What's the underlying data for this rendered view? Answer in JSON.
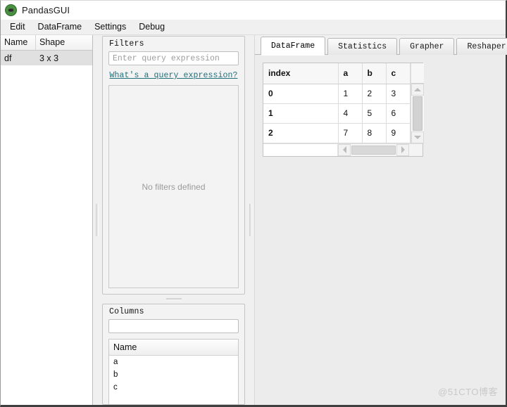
{
  "window": {
    "title": "PandasGUI",
    "icon": "pandas-logo-icon"
  },
  "menubar": {
    "items": [
      {
        "label": "Edit"
      },
      {
        "label": "DataFrame"
      },
      {
        "label": "Settings"
      },
      {
        "label": "Debug"
      }
    ]
  },
  "dataframe_list": {
    "headers": [
      "Name",
      "Shape"
    ],
    "rows": [
      {
        "name": "df",
        "shape": "3 x 3",
        "selected": true
      }
    ]
  },
  "filters": {
    "title": "Filters",
    "query_placeholder": "Enter query expression",
    "query_value": "",
    "help_link": "What's a query expression?",
    "empty_text": "No filters defined"
  },
  "columns": {
    "title": "Columns",
    "search_placeholder": "",
    "search_value": "",
    "header": "Name",
    "items": [
      "a",
      "b",
      "c"
    ]
  },
  "tabs": [
    {
      "label": "DataFrame",
      "active": true
    },
    {
      "label": "Statistics",
      "active": false
    },
    {
      "label": "Grapher",
      "active": false
    },
    {
      "label": "Reshaper",
      "active": false
    }
  ],
  "table": {
    "headers": [
      "index",
      "a",
      "b",
      "c"
    ],
    "rows": [
      {
        "index": "0",
        "values": [
          "1",
          "2",
          "3"
        ]
      },
      {
        "index": "1",
        "values": [
          "4",
          "5",
          "6"
        ]
      },
      {
        "index": "2",
        "values": [
          "7",
          "8",
          "9"
        ]
      }
    ]
  },
  "watermark": "@51CTO博客",
  "colors": {
    "link": "#20707c",
    "accent_green": "#4c9a3f",
    "selection": "#e0e0e0",
    "panel_bg": "#f0f0f0"
  }
}
